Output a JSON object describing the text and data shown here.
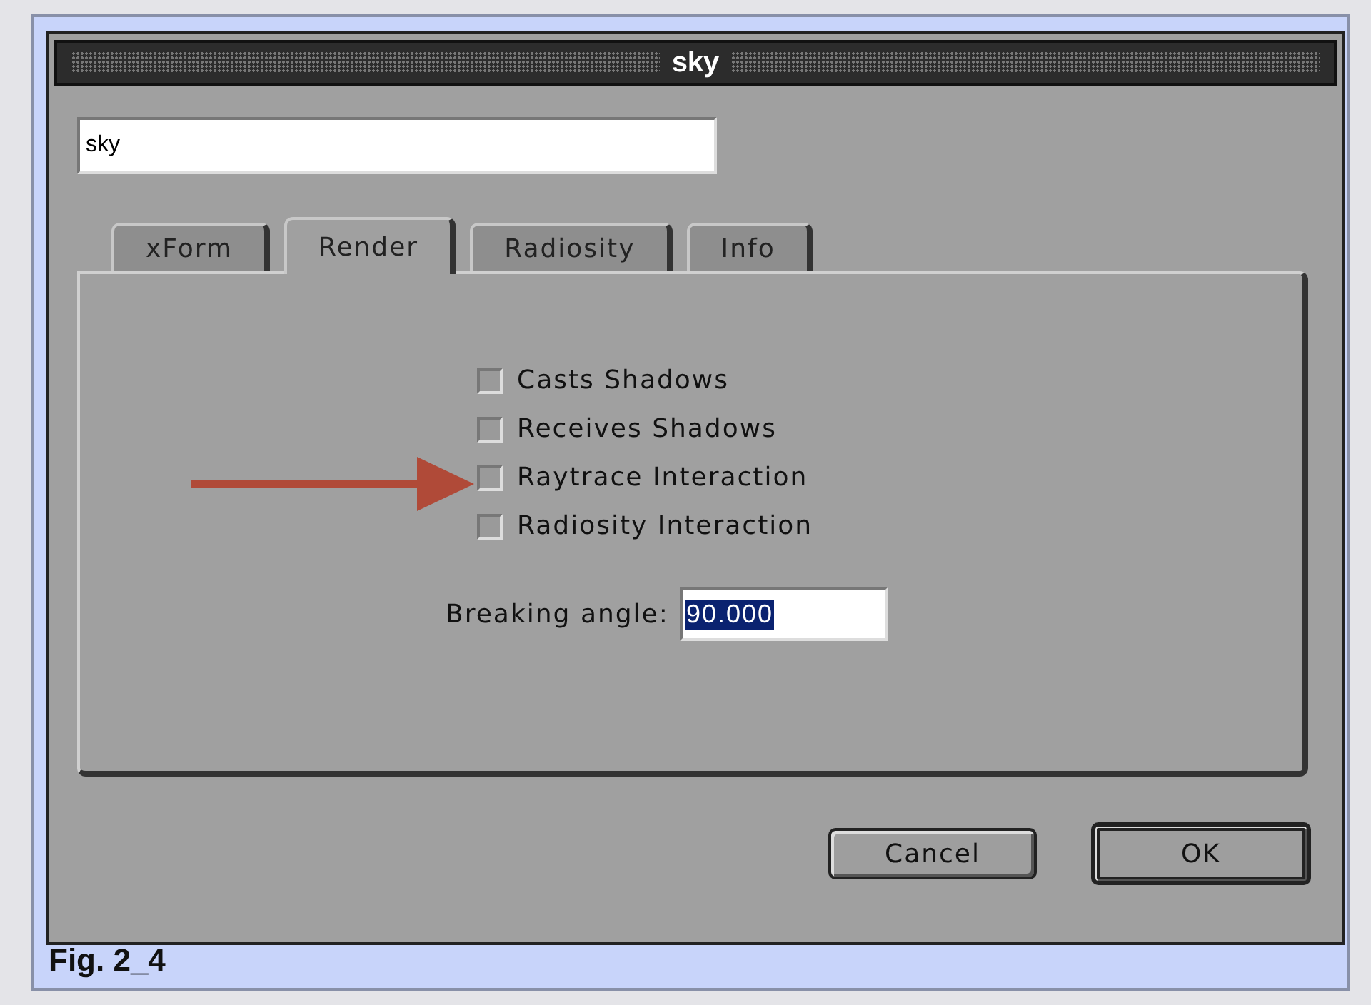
{
  "window": {
    "title": "sky"
  },
  "name_field": {
    "value": "sky"
  },
  "tabs": [
    {
      "label": "xForm",
      "selected": false
    },
    {
      "label": "Render",
      "selected": true
    },
    {
      "label": "Radiosity",
      "selected": false
    },
    {
      "label": "Info",
      "selected": false
    }
  ],
  "checkboxes": [
    {
      "label": "Casts Shadows",
      "checked": false
    },
    {
      "label": "Receives Shadows",
      "checked": false
    },
    {
      "label": "Raytrace Interaction",
      "checked": false
    },
    {
      "label": "Radiosity Interaction",
      "checked": false
    }
  ],
  "breaking_angle": {
    "label": "Breaking angle:",
    "value": "90.000",
    "text_selected": true
  },
  "buttons": [
    {
      "label": "Cancel",
      "default": false
    },
    {
      "label": "OK",
      "default": true
    }
  ],
  "caption": "Fig. 2_4"
}
